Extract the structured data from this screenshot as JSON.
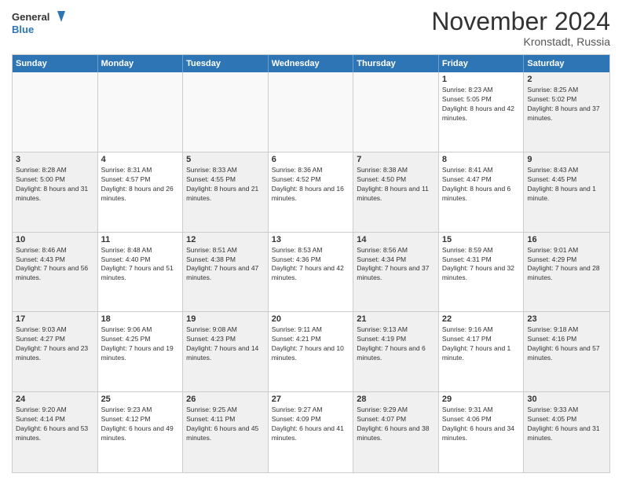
{
  "logo": {
    "line1": "General",
    "line2": "Blue"
  },
  "title": "November 2024",
  "location": "Kronstadt, Russia",
  "days_header": [
    "Sunday",
    "Monday",
    "Tuesday",
    "Wednesday",
    "Thursday",
    "Friday",
    "Saturday"
  ],
  "weeks": [
    [
      {
        "day": "",
        "info": ""
      },
      {
        "day": "",
        "info": ""
      },
      {
        "day": "",
        "info": ""
      },
      {
        "day": "",
        "info": ""
      },
      {
        "day": "",
        "info": ""
      },
      {
        "day": "1",
        "info": "Sunrise: 8:23 AM\nSunset: 5:05 PM\nDaylight: 8 hours and 42 minutes."
      },
      {
        "day": "2",
        "info": "Sunrise: 8:25 AM\nSunset: 5:02 PM\nDaylight: 8 hours and 37 minutes."
      }
    ],
    [
      {
        "day": "3",
        "info": "Sunrise: 8:28 AM\nSunset: 5:00 PM\nDaylight: 8 hours and 31 minutes."
      },
      {
        "day": "4",
        "info": "Sunrise: 8:31 AM\nSunset: 4:57 PM\nDaylight: 8 hours and 26 minutes."
      },
      {
        "day": "5",
        "info": "Sunrise: 8:33 AM\nSunset: 4:55 PM\nDaylight: 8 hours and 21 minutes."
      },
      {
        "day": "6",
        "info": "Sunrise: 8:36 AM\nSunset: 4:52 PM\nDaylight: 8 hours and 16 minutes."
      },
      {
        "day": "7",
        "info": "Sunrise: 8:38 AM\nSunset: 4:50 PM\nDaylight: 8 hours and 11 minutes."
      },
      {
        "day": "8",
        "info": "Sunrise: 8:41 AM\nSunset: 4:47 PM\nDaylight: 8 hours and 6 minutes."
      },
      {
        "day": "9",
        "info": "Sunrise: 8:43 AM\nSunset: 4:45 PM\nDaylight: 8 hours and 1 minute."
      }
    ],
    [
      {
        "day": "10",
        "info": "Sunrise: 8:46 AM\nSunset: 4:43 PM\nDaylight: 7 hours and 56 minutes."
      },
      {
        "day": "11",
        "info": "Sunrise: 8:48 AM\nSunset: 4:40 PM\nDaylight: 7 hours and 51 minutes."
      },
      {
        "day": "12",
        "info": "Sunrise: 8:51 AM\nSunset: 4:38 PM\nDaylight: 7 hours and 47 minutes."
      },
      {
        "day": "13",
        "info": "Sunrise: 8:53 AM\nSunset: 4:36 PM\nDaylight: 7 hours and 42 minutes."
      },
      {
        "day": "14",
        "info": "Sunrise: 8:56 AM\nSunset: 4:34 PM\nDaylight: 7 hours and 37 minutes."
      },
      {
        "day": "15",
        "info": "Sunrise: 8:59 AM\nSunset: 4:31 PM\nDaylight: 7 hours and 32 minutes."
      },
      {
        "day": "16",
        "info": "Sunrise: 9:01 AM\nSunset: 4:29 PM\nDaylight: 7 hours and 28 minutes."
      }
    ],
    [
      {
        "day": "17",
        "info": "Sunrise: 9:03 AM\nSunset: 4:27 PM\nDaylight: 7 hours and 23 minutes."
      },
      {
        "day": "18",
        "info": "Sunrise: 9:06 AM\nSunset: 4:25 PM\nDaylight: 7 hours and 19 minutes."
      },
      {
        "day": "19",
        "info": "Sunrise: 9:08 AM\nSunset: 4:23 PM\nDaylight: 7 hours and 14 minutes."
      },
      {
        "day": "20",
        "info": "Sunrise: 9:11 AM\nSunset: 4:21 PM\nDaylight: 7 hours and 10 minutes."
      },
      {
        "day": "21",
        "info": "Sunrise: 9:13 AM\nSunset: 4:19 PM\nDaylight: 7 hours and 6 minutes."
      },
      {
        "day": "22",
        "info": "Sunrise: 9:16 AM\nSunset: 4:17 PM\nDaylight: 7 hours and 1 minute."
      },
      {
        "day": "23",
        "info": "Sunrise: 9:18 AM\nSunset: 4:16 PM\nDaylight: 6 hours and 57 minutes."
      }
    ],
    [
      {
        "day": "24",
        "info": "Sunrise: 9:20 AM\nSunset: 4:14 PM\nDaylight: 6 hours and 53 minutes."
      },
      {
        "day": "25",
        "info": "Sunrise: 9:23 AM\nSunset: 4:12 PM\nDaylight: 6 hours and 49 minutes."
      },
      {
        "day": "26",
        "info": "Sunrise: 9:25 AM\nSunset: 4:11 PM\nDaylight: 6 hours and 45 minutes."
      },
      {
        "day": "27",
        "info": "Sunrise: 9:27 AM\nSunset: 4:09 PM\nDaylight: 6 hours and 41 minutes."
      },
      {
        "day": "28",
        "info": "Sunrise: 9:29 AM\nSunset: 4:07 PM\nDaylight: 6 hours and 38 minutes."
      },
      {
        "day": "29",
        "info": "Sunrise: 9:31 AM\nSunset: 4:06 PM\nDaylight: 6 hours and 34 minutes."
      },
      {
        "day": "30",
        "info": "Sunrise: 9:33 AM\nSunset: 4:05 PM\nDaylight: 6 hours and 31 minutes."
      }
    ]
  ]
}
